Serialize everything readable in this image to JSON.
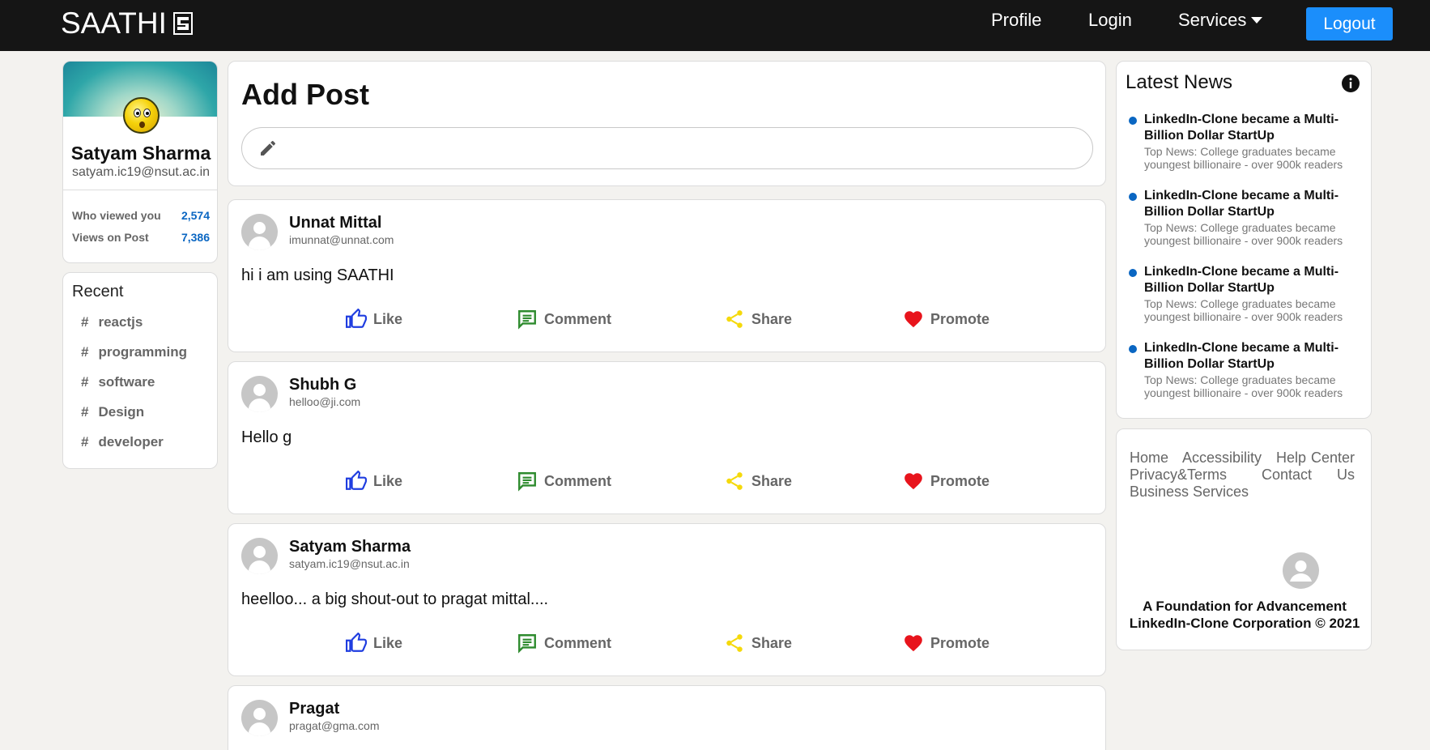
{
  "navbar": {
    "brand": "SAATHI",
    "profile": "Profile",
    "login": "Login",
    "services": "Services",
    "logout": "Logout"
  },
  "profile": {
    "name": "Satyam Sharma",
    "email": "satyam.ic19@nsut.ac.in",
    "stats": [
      {
        "label": "Who viewed you",
        "value": "2,574"
      },
      {
        "label": "Views on Post",
        "value": "7,386"
      }
    ]
  },
  "recent": {
    "title": "Recent",
    "items": [
      "reactjs",
      "programming",
      "software",
      "Design",
      "developer"
    ]
  },
  "add_post": {
    "title": "Add Post"
  },
  "actions": {
    "like": "Like",
    "comment": "Comment",
    "share": "Share",
    "promote": "Promote"
  },
  "posts": [
    {
      "name": "Unnat Mittal",
      "email": "imunnat@unnat.com",
      "text": "hi i am using SAATHI"
    },
    {
      "name": "Shubh G",
      "email": "helloo@ji.com",
      "text": "Hello g"
    },
    {
      "name": "Satyam Sharma",
      "email": "satyam.ic19@nsut.ac.in",
      "text": "heelloo... a big shout-out to pragat mittal...."
    },
    {
      "name": "Pragat",
      "email": "pragat@gma.com",
      "text": ""
    }
  ],
  "news": {
    "title": "Latest News",
    "items": [
      {
        "headline": "LinkedIn-Clone became a Multi-Billion Dollar StartUp",
        "sub": "Top News: College graduates became youngest billionaire - over 900k readers"
      },
      {
        "headline": "LinkedIn-Clone became a Multi-Billion Dollar StartUp",
        "sub": "Top News: College graduates became youngest billionaire - over 900k readers"
      },
      {
        "headline": "LinkedIn-Clone became a Multi-Billion Dollar StartUp",
        "sub": "Top News: College graduates became youngest billionaire - over 900k readers"
      },
      {
        "headline": "LinkedIn-Clone became a Multi-Billion Dollar StartUp",
        "sub": "Top News: College graduates became youngest billionaire - over 900k readers"
      }
    ]
  },
  "footer": {
    "links": [
      "Home",
      "Accessibility",
      "Help Center",
      "Privacy&Terms",
      "Contact Us",
      "Business Services"
    ],
    "line1": "A Foundation for Advancement",
    "line2": "LinkedIn-Clone Corporation © 2021"
  },
  "colors": {
    "brand_blue": "#0a66c2",
    "logout_blue": "#1b8efb",
    "like_blue": "#1f3de0",
    "comment_green": "#2e8b2e",
    "share_yellow": "#f5d90a",
    "promote_red": "#e8141c"
  },
  "icons": {
    "like": "thumb-up-icon",
    "comment": "comment-icon",
    "share": "share-icon",
    "promote": "heart-icon",
    "edit": "pencil-icon",
    "info": "info-icon"
  }
}
